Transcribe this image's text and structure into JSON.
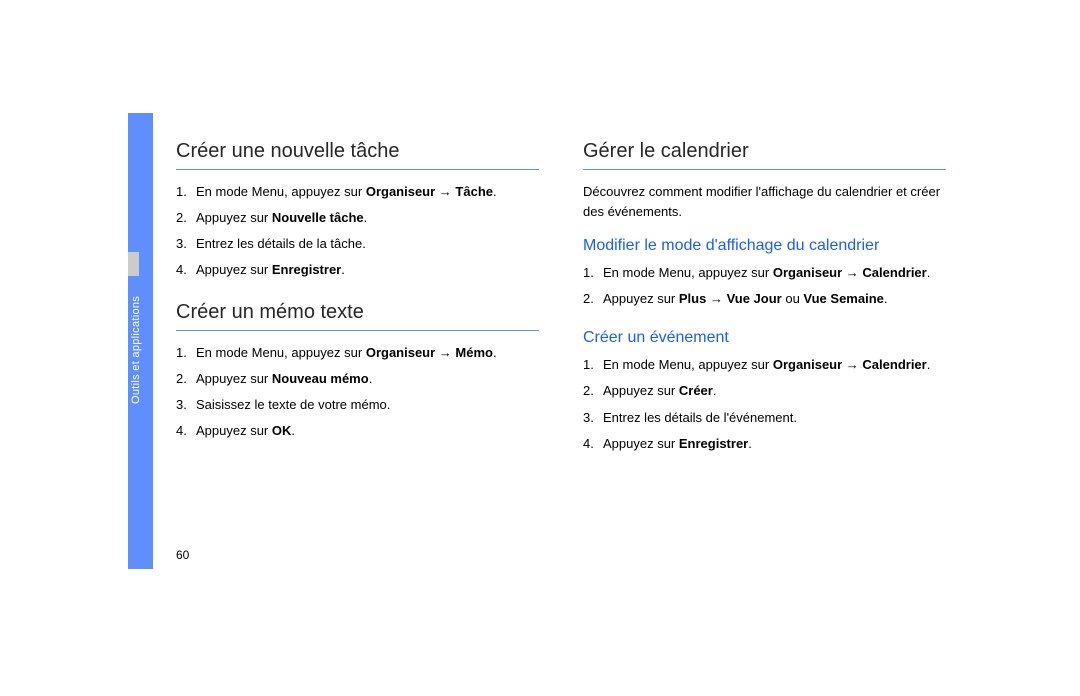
{
  "sidebar": {
    "label": "Outils et applications"
  },
  "pageNumber": "60",
  "col1": {
    "section1": {
      "title": "Créer une nouvelle tâche",
      "items": [
        {
          "pre": "En mode Menu, appuyez sur ",
          "b1": "Organiseur",
          "arrow": " → ",
          "b2": "Tâche",
          "post": "."
        },
        {
          "pre": "Appuyez sur ",
          "b1": "Nouvelle tâche",
          "post": "."
        },
        {
          "pre": "Entrez les détails de la tâche."
        },
        {
          "pre": "Appuyez sur ",
          "b1": "Enregistrer",
          "post": "."
        }
      ]
    },
    "section2": {
      "title": "Créer un mémo texte",
      "items": [
        {
          "pre": "En mode Menu, appuyez sur ",
          "b1": "Organiseur",
          "arrow": " → ",
          "b2": "Mémo",
          "post": "."
        },
        {
          "pre": "Appuyez sur ",
          "b1": "Nouveau mémo",
          "post": "."
        },
        {
          "pre": "Saisissez le texte de votre mémo."
        },
        {
          "pre": "Appuyez sur ",
          "b1": "OK",
          "post": "."
        }
      ]
    }
  },
  "col2": {
    "section1": {
      "title": "Gérer le calendrier",
      "intro": "Découvrez comment modifier l'affichage du calendrier et créer des événements."
    },
    "section2": {
      "title": "Modifier le mode d'affichage du calendrier",
      "items": [
        {
          "pre": "En mode Menu, appuyez sur ",
          "b1": "Organiseur",
          "arrow": " → ",
          "b2": "Calendrier",
          "post": "."
        },
        {
          "pre": "Appuyez sur ",
          "b1": "Plus",
          "arrow": " → ",
          "b2": "Vue Jour",
          "mid": " ou ",
          "b3": "Vue Semaine",
          "post": "."
        }
      ]
    },
    "section3": {
      "title": "Créer un événement",
      "items": [
        {
          "pre": "En mode Menu, appuyez sur ",
          "b1": "Organiseur",
          "arrow": " → ",
          "b2": "Calendrier",
          "post": "."
        },
        {
          "pre": "Appuyez sur ",
          "b1": "Créer",
          "post": "."
        },
        {
          "pre": "Entrez les détails de l'événement."
        },
        {
          "pre": "Appuyez sur ",
          "b1": "Enregistrer",
          "post": "."
        }
      ]
    }
  }
}
